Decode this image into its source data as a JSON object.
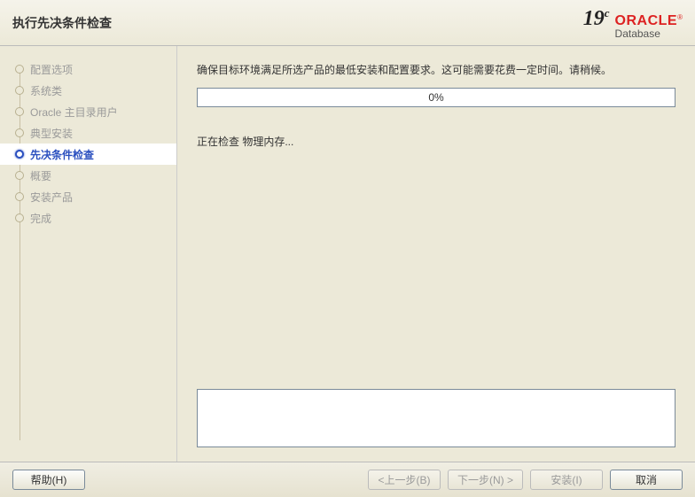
{
  "header": {
    "title": "执行先决条件检查",
    "brand_version": "19",
    "brand_version_suffix": "c",
    "brand_name": "ORACLE",
    "brand_reg": "®",
    "brand_product": "Database"
  },
  "sidebar": {
    "steps": [
      {
        "label": "配置选项"
      },
      {
        "label": "系统类"
      },
      {
        "label": "Oracle 主目录用户"
      },
      {
        "label": "典型安装"
      },
      {
        "label": "先决条件检查"
      },
      {
        "label": "概要"
      },
      {
        "label": "安装产品"
      },
      {
        "label": "完成"
      }
    ],
    "current_index": 4
  },
  "content": {
    "description": "确保目标环境满足所选产品的最低安装和配置要求。这可能需要花费一定时间。请稍候。",
    "progress_percent": "0%",
    "status_text": "正在检查 物理内存..."
  },
  "footer": {
    "help": "帮助(H)",
    "back": "<上一步(B)",
    "next": "下一步(N) >",
    "install": "安装(I)",
    "cancel": "取消"
  }
}
